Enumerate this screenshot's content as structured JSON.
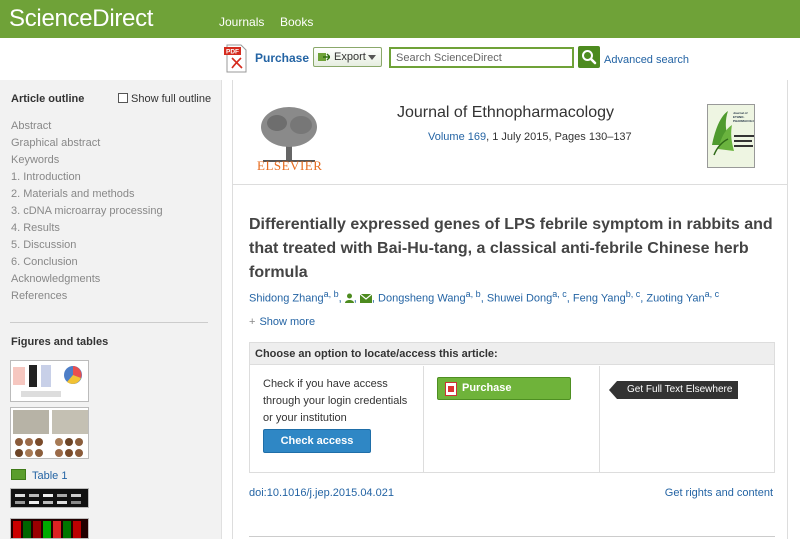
{
  "topbar": {
    "brand": "ScienceDirect",
    "nav": [
      "Journals",
      "Books"
    ]
  },
  "toolbar": {
    "purchase_label": "Purchase",
    "export_label": "Export",
    "search_placeholder": "Search ScienceDirect",
    "advanced_search": "Advanced search"
  },
  "sidebar": {
    "outline_title": "Article outline",
    "show_full_outline": "Show full outline",
    "outline_items": [
      "Abstract",
      "Graphical abstract",
      "Keywords",
      "1. Introduction",
      "2. Materials and methods",
      "3. cDNA microarray processing",
      "4. Results",
      "5. Discussion",
      "6. Conclusion",
      "Acknowledgments",
      "References"
    ],
    "figures_title": "Figures and tables",
    "table_link": "Table 1"
  },
  "journal": {
    "publisher_logo_text": "ELSEVIER",
    "title": "Journal of Ethnopharmacology",
    "volume": "Volume 169",
    "issue_details": ", 1 July 2015, Pages 130–137",
    "cover_text": "Journal of ETHNO-PHARMACOLOGY"
  },
  "article": {
    "title": "Differentially expressed genes of LPS febrile symptom in rabbits and that treated with Bai-Hu-tang, a classical anti-febrile Chinese herb formula",
    "authors": [
      {
        "name": "Shidong Zhang",
        "sup": "a, b"
      },
      {
        "name": "Dongsheng Wang",
        "sup": "a, b"
      },
      {
        "name": "Shuwei Dong",
        "sup": "a, c"
      },
      {
        "name": "Feng Yang",
        "sup": "b, c"
      },
      {
        "name": "Zuoting Yan",
        "sup": "a, c"
      }
    ],
    "show_more": "Show more",
    "doi": "doi:10.1016/j.jep.2015.04.021",
    "rights": "Get rights and content"
  },
  "access": {
    "heading": "Choose an option to locate/access this article:",
    "description": "Check if you have access through your login credentials or your institution",
    "check_access": "Check access",
    "purchase": "Purchase",
    "full_text": "Get Full Text Elsewhere"
  },
  "colors": {
    "brand_green": "#6fa238",
    "link_blue": "#2464a4",
    "button_blue": "#2f87c5",
    "purchase_green": "#6fb33a",
    "elsevier_orange": "#e76b1e"
  }
}
